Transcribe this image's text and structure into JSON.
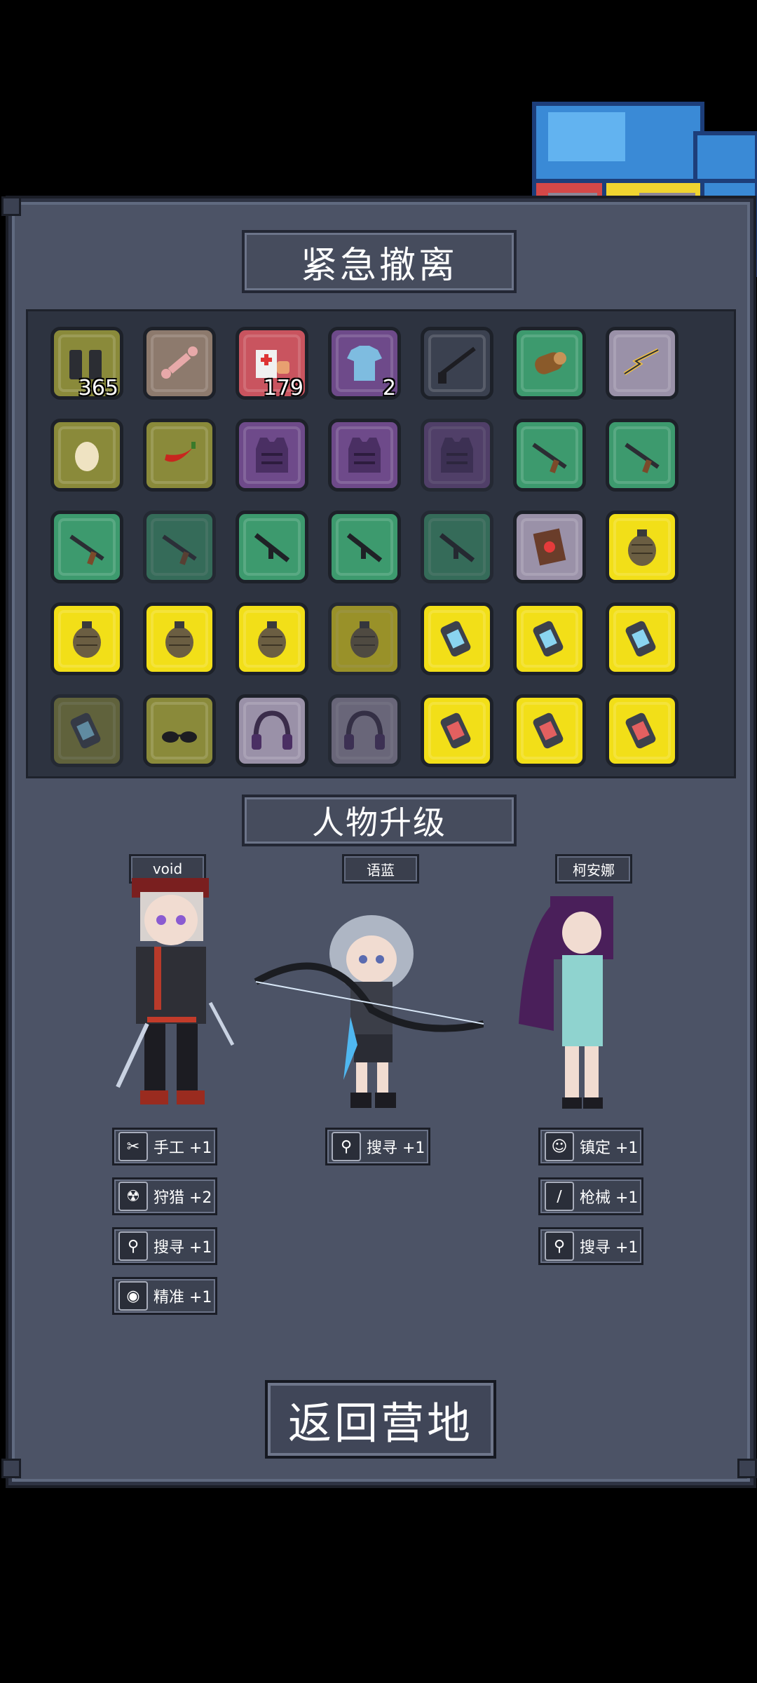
{
  "title": "紧急撤离",
  "upgrade_title": "人物升级",
  "return_label": "返回营地",
  "inventory": [
    {
      "item": "magazine",
      "bg": "olive",
      "qty": "365"
    },
    {
      "item": "bone",
      "bg": "tan"
    },
    {
      "item": "medkit",
      "bg": "red",
      "qty": "179"
    },
    {
      "item": "shirt",
      "bg": "purple",
      "qty": "2"
    },
    {
      "item": "shotgun",
      "bg": "dark"
    },
    {
      "item": "wood-log",
      "bg": "green"
    },
    {
      "item": "wire",
      "bg": "lilac"
    },
    {
      "item": "egg",
      "bg": "olive"
    },
    {
      "item": "chili",
      "bg": "olive"
    },
    {
      "item": "armor-vest",
      "bg": "purple"
    },
    {
      "item": "armor-vest",
      "bg": "purple"
    },
    {
      "item": "armor-vest",
      "bg": "purple",
      "dim": true
    },
    {
      "item": "rifle",
      "bg": "green"
    },
    {
      "item": "rifle",
      "bg": "green"
    },
    {
      "item": "rifle",
      "bg": "green"
    },
    {
      "item": "rifle",
      "bg": "green",
      "dim": true
    },
    {
      "item": "assault-rifle",
      "bg": "green"
    },
    {
      "item": "assault-rifle",
      "bg": "green"
    },
    {
      "item": "assault-rifle",
      "bg": "green",
      "dim": true
    },
    {
      "item": "book",
      "bg": "lilac"
    },
    {
      "item": "grenade",
      "bg": "yellow"
    },
    {
      "item": "grenade",
      "bg": "yellow"
    },
    {
      "item": "grenade",
      "bg": "yellow"
    },
    {
      "item": "grenade",
      "bg": "yellow"
    },
    {
      "item": "grenade",
      "bg": "yellow",
      "dim": true
    },
    {
      "item": "can-blue",
      "bg": "yellow"
    },
    {
      "item": "can-blue",
      "bg": "yellow"
    },
    {
      "item": "can-blue",
      "bg": "yellow"
    },
    {
      "item": "can-blue",
      "bg": "olive",
      "dim": true
    },
    {
      "item": "glasses",
      "bg": "olive"
    },
    {
      "item": "headphones",
      "bg": "lilac"
    },
    {
      "item": "headphones",
      "bg": "lilac",
      "dim": true
    },
    {
      "item": "can-red",
      "bg": "yellow"
    },
    {
      "item": "can-red",
      "bg": "yellow"
    },
    {
      "item": "can-red",
      "bg": "yellow"
    }
  ],
  "characters": [
    {
      "name": "void",
      "stats": [
        {
          "icon": "scissors-icon",
          "glyph": "✂",
          "label": "手工 +1"
        },
        {
          "icon": "radiation-icon",
          "glyph": "☢",
          "label": "狩猎 +2"
        },
        {
          "icon": "magnifier-icon",
          "glyph": "⚲",
          "label": "搜寻 +1"
        },
        {
          "icon": "eye-icon",
          "glyph": "◉",
          "label": "精准 +1"
        }
      ]
    },
    {
      "name": "语蓝",
      "stats": [
        {
          "icon": "magnifier-icon",
          "glyph": "⚲",
          "label": "搜寻 +1"
        }
      ]
    },
    {
      "name": "柯安娜",
      "stats": [
        {
          "icon": "cat-face-icon",
          "glyph": "☺",
          "label": "镇定 +1"
        },
        {
          "icon": "blade-icon",
          "glyph": "∕",
          "label": "枪械 +1"
        },
        {
          "icon": "magnifier-icon",
          "glyph": "⚲",
          "label": "搜寻 +1"
        }
      ]
    }
  ],
  "colors": {
    "olive": "#8a8a3a",
    "tan": "#8d7a6d",
    "red": "#c9545f",
    "purple": "#6e4a8a",
    "dark": "#3b4150",
    "green": "#3d9a6e",
    "lilac": "#9a91a8",
    "yellow": "#f2df18"
  }
}
